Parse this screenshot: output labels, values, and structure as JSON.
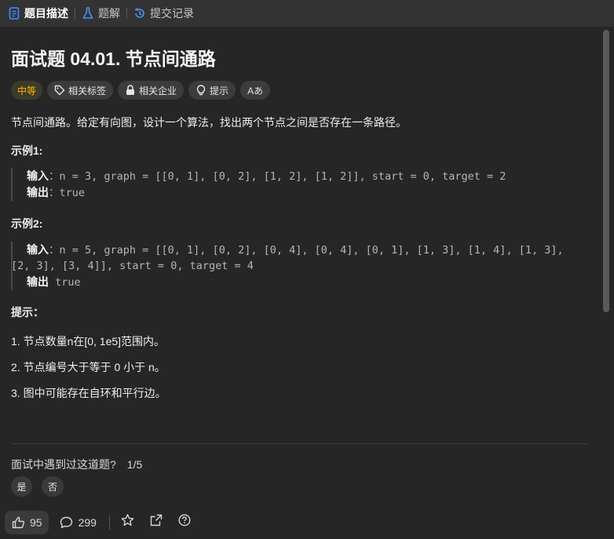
{
  "tabs": [
    {
      "label": "题目描述",
      "icon": "document-icon"
    },
    {
      "label": "题解",
      "icon": "flask-icon"
    },
    {
      "label": "提交记录",
      "icon": "history-icon"
    }
  ],
  "problem": {
    "title": "面试题 04.01. 节点间通路",
    "difficulty": "中等",
    "tags": [
      {
        "label": "相关标签",
        "icon": "tag-icon"
      },
      {
        "label": "相关企业",
        "icon": "lock-icon"
      },
      {
        "label": "提示",
        "icon": "lightbulb-icon"
      }
    ],
    "translate_label": "Aあ",
    "description": "节点间通路。给定有向图，设计一个算法，找出两个节点之间是否存在一条路径。",
    "example1_title": "示例1:",
    "example1": {
      "input_label": "输入",
      "input": "：n = 3, graph = [[0, 1], [0, 2], [1, 2], [1, 2]], start = 0, target = 2",
      "output_label": "输出",
      "output": "：true"
    },
    "example2_title": "示例2:",
    "example2": {
      "input_label": "输入",
      "input_line1": "：n = 5, graph = [[0, 1], [0, 2], [0, 4], [0, 4], [0, 1], [1, 3], [1, 4], [1, 3],",
      "input_line2": "[2, 3], [3, 4]], start = 0, target = 4",
      "output_label": "输出",
      "output": " true"
    },
    "hints_title": "提示：",
    "hints": [
      "1. 节点数量n在[0, 1e5]范围内。",
      "2. 节点编号大于等于 0 小于 n。",
      "3. 图中可能存在自环和平行边。"
    ]
  },
  "interview": {
    "question": "面试中遇到过这道题?",
    "count": "1/5",
    "yes": "是",
    "no": "否"
  },
  "footer": {
    "likes": "95",
    "comments": "299"
  },
  "colors": {
    "background": "#262626",
    "tabbar": "#333333",
    "medium": "#ffb800"
  }
}
